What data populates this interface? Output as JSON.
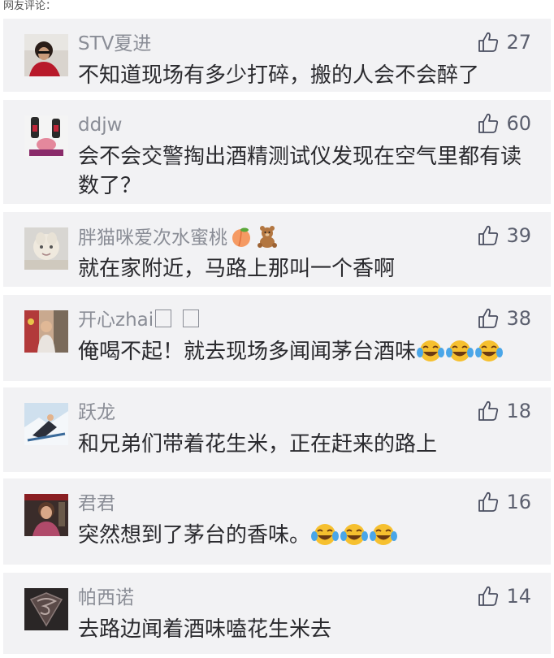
{
  "section_title": "网友评论：",
  "comments": [
    {
      "user": "STV夏进",
      "likes": "27",
      "text": "不知道现场有多少打碎，搬的人会不会醉了"
    },
    {
      "user": "ddjw",
      "likes": "60",
      "text": "会不会交警掏出酒精测试仪发现在空气里都有读数了？"
    },
    {
      "user": "胖猫咪爱次水蜜桃",
      "likes": "39",
      "text": "就在家附近，马路上那叫一个香啊",
      "name_emojis": [
        "peach-emoji",
        "teddy-bear-emoji"
      ]
    },
    {
      "user": "开心zhai",
      "likes": "38",
      "text": "俺喝不起！就去现场多闻闻茅台酒味",
      "name_glyphs": [
        "□",
        "□"
      ],
      "trailing_emoji": "tears-of-joy",
      "trailing_count": 3
    },
    {
      "user": "跃龙",
      "likes": "18",
      "text": "和兄弟们带着花生米，正在赶来的路上"
    },
    {
      "user": "君君",
      "likes": "16",
      "text": "突然想到了茅台的香味。",
      "trailing_emoji": "tears-of-joy",
      "trailing_count": 3
    },
    {
      "user": "帕西诺",
      "likes": "14",
      "text": "去路边闻着酒味嗑花生米去"
    }
  ],
  "colors": {
    "card_bg": "#f2f2f4",
    "username": "#8a8d96",
    "text": "#2a2a2e",
    "like_icon": "#4a4e60"
  },
  "icons": {
    "like": "thumbs-up-outline-icon"
  }
}
